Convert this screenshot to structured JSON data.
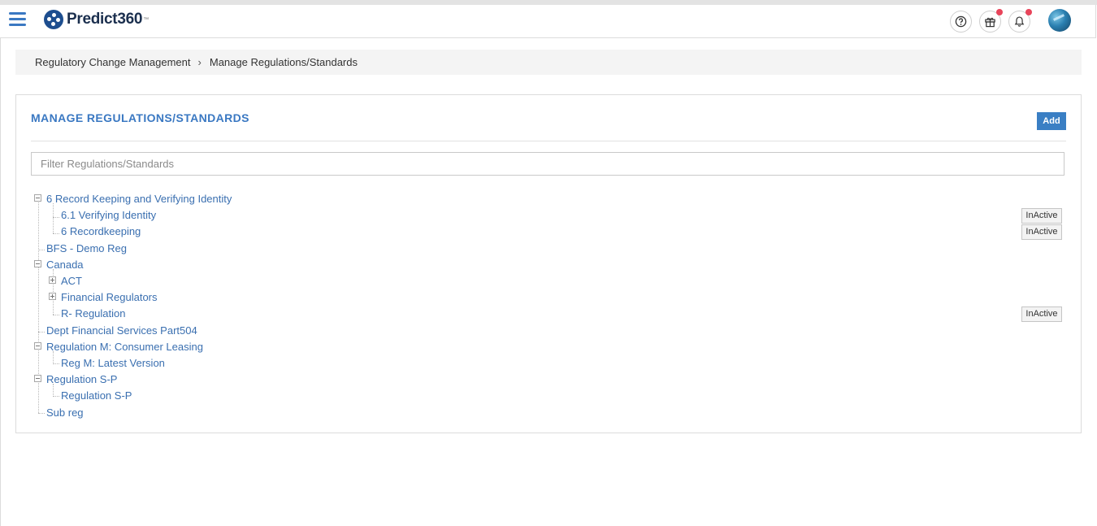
{
  "header": {
    "brand": "Predict360",
    "brand_mark": "™",
    "icons": [
      "menu-icon",
      "help-icon",
      "gift-icon",
      "bell-icon"
    ]
  },
  "breadcrumb": {
    "items": [
      "Regulatory Change Management",
      "Manage Regulations/Standards"
    ],
    "separator": "›"
  },
  "panel": {
    "title": "MANAGE REGULATIONS/STANDARDS",
    "add_label": "Add",
    "filter_placeholder": "Filter Regulations/Standards"
  },
  "tree": [
    {
      "label": "6 Record Keeping and Verifying Identity",
      "children": [
        {
          "label": "6.1 Verifying Identity",
          "status": "InActive"
        },
        {
          "label": "6 Recordkeeping",
          "status": "InActive"
        }
      ]
    },
    {
      "label": "BFS - Demo Reg"
    },
    {
      "label": "Canada",
      "children": [
        {
          "label": "ACT",
          "collapsed": true
        },
        {
          "label": "Financial Regulators",
          "collapsed": true
        },
        {
          "label": "R- Regulation",
          "status": "InActive"
        }
      ]
    },
    {
      "label": "Dept Financial Services Part504"
    },
    {
      "label": "Regulation M: Consumer Leasing",
      "children": [
        {
          "label": "Reg M: Latest Version"
        }
      ]
    },
    {
      "label": "Regulation S-P",
      "children": [
        {
          "label": "Regulation S-P"
        }
      ]
    },
    {
      "label": "Sub reg"
    }
  ],
  "colors": {
    "accent": "#3a78c2",
    "link": "#3a6fb0",
    "notification": "#e8445a"
  }
}
